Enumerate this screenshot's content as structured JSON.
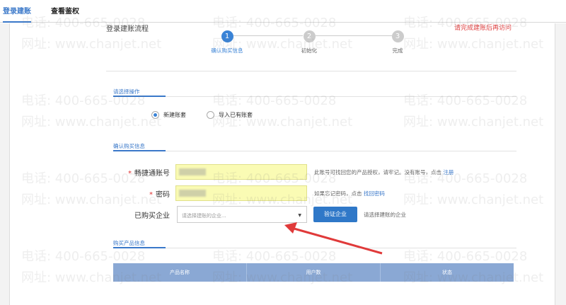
{
  "tabs": [
    {
      "label": "登录建账"
    },
    {
      "label": "查看鉴权"
    }
  ],
  "page_title": "登录建账流程",
  "top_right_link": "请完成建账后再访问",
  "steps": [
    {
      "number": "1",
      "label": "确认购买信息"
    },
    {
      "number": "2",
      "label": "初始化"
    },
    {
      "number": "3",
      "label": "完成"
    }
  ],
  "operation_section": {
    "title": "请选择操作"
  },
  "radios": [
    {
      "label": "新建账套",
      "selected": true
    },
    {
      "label": "导入已有账套",
      "selected": false
    }
  ],
  "purchase_section": {
    "title": "确认购买信息"
  },
  "account_field": {
    "label": "畅捷通账号",
    "hint": "此账号可找回您的产品授权，请牢记。没有账号，点击",
    "hint_link": "注册"
  },
  "password_field": {
    "label": "密码",
    "hint": "如果忘记密码，点击",
    "hint_link": "找回密码"
  },
  "company_field": {
    "label": "已购买企业",
    "placeholder": "请选择建账的企业...",
    "button": "验证企业",
    "hint": "请选择建账的企业"
  },
  "product_section": {
    "title": "购买产品信息"
  },
  "table_headers": [
    "产品名称",
    "用户数",
    "状态"
  ],
  "watermarks": {
    "phone": "电话: 400-665-0028",
    "site": "网址: www.chanjet.net"
  },
  "colors": {
    "accent": "#3a83d6",
    "highlight_input": "#fafbb4",
    "arrow": "#e03a3a",
    "table_header": "#8aa8d4"
  }
}
